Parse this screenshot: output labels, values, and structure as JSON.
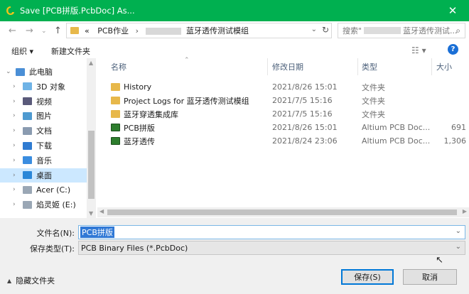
{
  "window": {
    "title": "Save [PCB拼版.PcbDoc] As...",
    "close_glyph": "✕"
  },
  "address": {
    "prefix": "«",
    "segment1": "PCB作业",
    "separator": "›",
    "segment2": "蓝牙透传测试模组",
    "search_prefix": "搜索\"",
    "search_suffix": "蓝牙透传测试..."
  },
  "toolbar": {
    "organize": "组织 ▾",
    "new_folder": "新建文件夹",
    "help": "?"
  },
  "nav": {
    "items": [
      {
        "label": "此电脑",
        "icon": "pc-icon",
        "color": "#4a8fd6",
        "arrow": "⌄"
      },
      {
        "label": "3D 对象",
        "icon": "3d-objects-icon",
        "color": "#6fb3e6",
        "arrow": "›"
      },
      {
        "label": "视频",
        "icon": "video-icon",
        "color": "#5a5a7a",
        "arrow": "›"
      },
      {
        "label": "图片",
        "icon": "pictures-icon",
        "color": "#4e9ad0",
        "arrow": "›"
      },
      {
        "label": "文档",
        "icon": "documents-icon",
        "color": "#8a9bb0",
        "arrow": "›"
      },
      {
        "label": "下载",
        "icon": "download-icon",
        "color": "#2f7bd1",
        "arrow": "›"
      },
      {
        "label": "音乐",
        "icon": "music-icon",
        "color": "#3a8de0",
        "arrow": "›"
      },
      {
        "label": "桌面",
        "icon": "desktop-icon",
        "color": "#2a87d8",
        "arrow": "›"
      },
      {
        "label": "Acer (C:)",
        "icon": "drive-icon",
        "color": "#9aa7b5",
        "arrow": "›"
      },
      {
        "label": "焰灵姬 (E:)",
        "icon": "drive-icon",
        "color": "#9aa7b5",
        "arrow": "›"
      }
    ]
  },
  "columns": {
    "name": "名称",
    "date": "修改日期",
    "type": "类型",
    "size": "大小"
  },
  "files": [
    {
      "name": "History",
      "date": "2021/8/26 15:01",
      "type": "文件夹",
      "size": "",
      "kind": "folder"
    },
    {
      "name": "Project Logs for 蓝牙透传测试模组",
      "date": "2021/7/5 15:16",
      "type": "文件夹",
      "size": "",
      "kind": "folder"
    },
    {
      "name": "蓝牙穿透集成库",
      "date": "2021/7/5 15:16",
      "type": "文件夹",
      "size": "",
      "kind": "folder"
    },
    {
      "name": "PCB拼版",
      "date": "2021/8/26 15:01",
      "type": "Altium PCB Doc...",
      "size": "691",
      "kind": "pcb"
    },
    {
      "name": "蓝牙透传",
      "date": "2021/8/24 23:06",
      "type": "Altium PCB Doc...",
      "size": "1,306",
      "kind": "pcb"
    }
  ],
  "form": {
    "filename_label": "文件名(N):",
    "filename_value": "PCB拼版",
    "filetype_label": "保存类型(T):",
    "filetype_value": "PCB Binary Files (*.PcbDoc)"
  },
  "footer": {
    "hide_folders": "隐藏文件夹",
    "save": "保存(S)",
    "cancel": "取消"
  },
  "colors": {
    "titlebar": "#00b050",
    "selection": "#cce8ff",
    "accent": "#0078d7"
  }
}
